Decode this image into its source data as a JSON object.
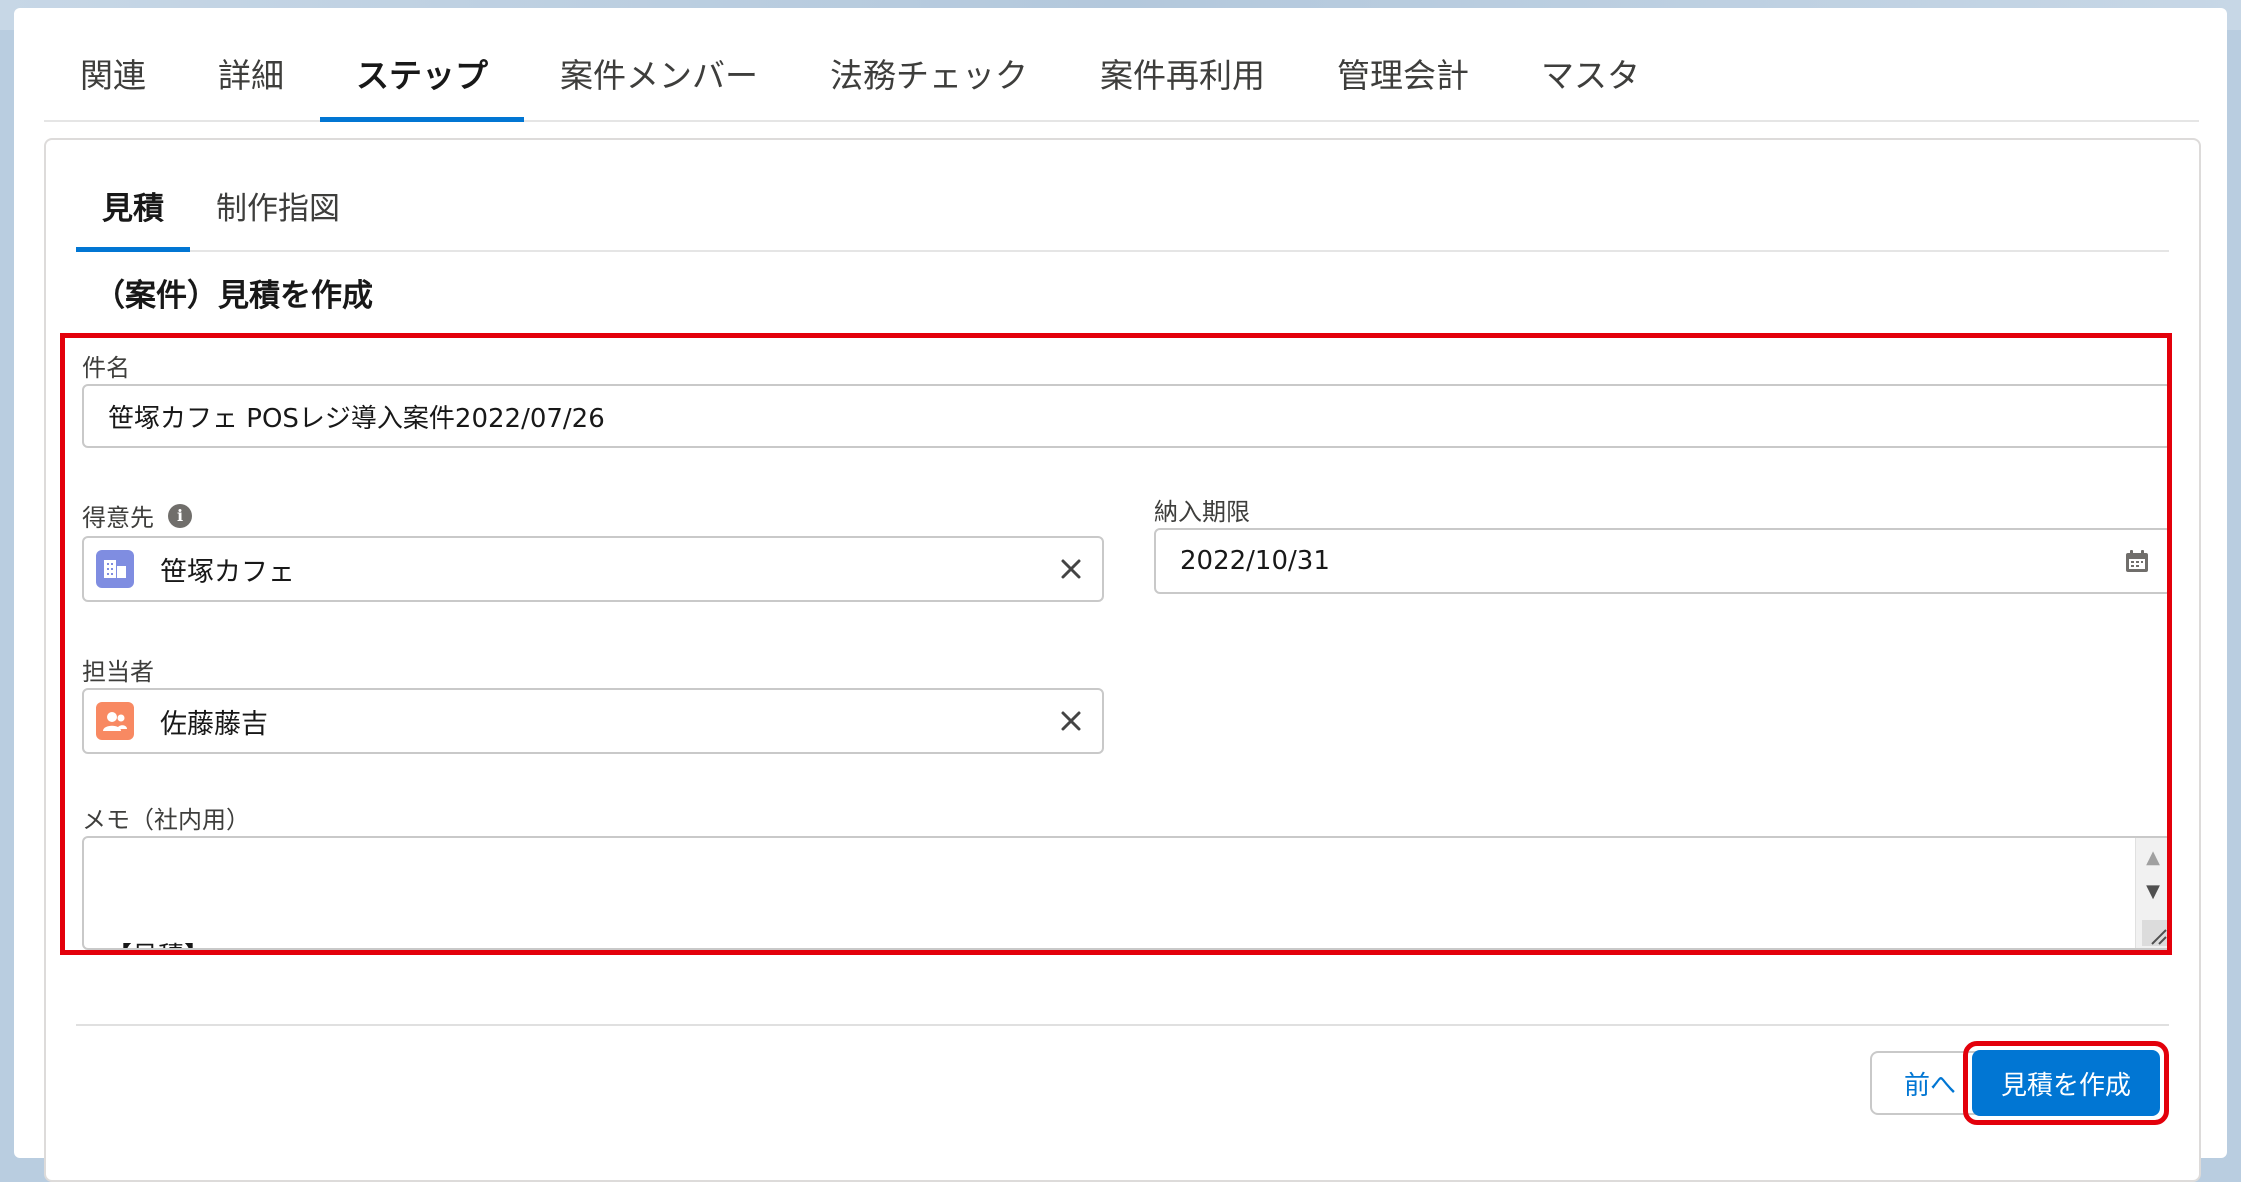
{
  "top_tabs": [
    "関連",
    "詳細",
    "ステップ",
    "案件メンバー",
    "法務チェック",
    "案件再利用",
    "管理会計",
    "マスタ"
  ],
  "active_top_tab": "ステップ",
  "sub_tabs": [
    "見積",
    "制作指図"
  ],
  "active_sub_tab": "見積",
  "form": {
    "title": "（案件）見積を作成",
    "subject_label": "件名",
    "subject_value": "笹塚カフェ POSレジ導入案件2022/07/26",
    "customer_label": "得意先",
    "customer_value": "笹塚カフェ",
    "due_label": "納入期限",
    "due_value": "2022/10/31",
    "owner_label": "担当者",
    "owner_value": "佐藤藤吉",
    "memo_label": "メモ（社内用）",
    "memo_visible_text": "【見積】"
  },
  "buttons": {
    "back": "前へ",
    "create": "見積を作成"
  },
  "colors": {
    "accent": "#0176d3",
    "highlight": "#e3000b",
    "account_icon": "#7f8de1",
    "user_icon": "#f88962"
  },
  "icons": {
    "info": "info-icon",
    "account": "account-icon",
    "user": "user-icon",
    "clear": "close-icon",
    "calendar": "calendar-icon"
  }
}
